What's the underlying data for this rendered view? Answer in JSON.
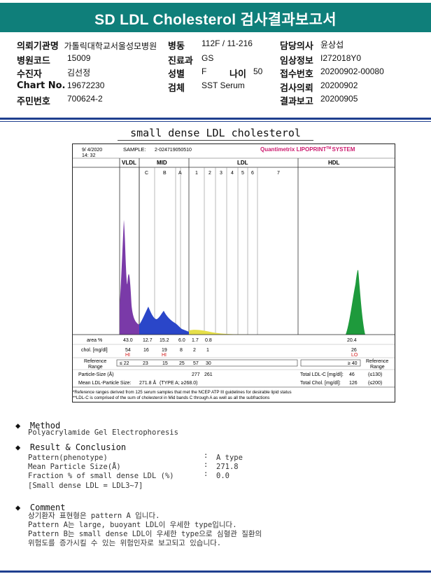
{
  "header": {
    "title": "SD LDL Cholesterol 검사결과보고서"
  },
  "info": {
    "col1": [
      {
        "label": "의뢰기관명",
        "value": "가톨릭대학교서울성모병원"
      },
      {
        "label": "병원코드",
        "value": "15009"
      },
      {
        "label": "수진자",
        "value": "김선정"
      },
      {
        "label": "Chart No.",
        "value": "19672230"
      },
      {
        "label": "주민번호",
        "value": "700624-2"
      }
    ],
    "col2": [
      {
        "label": "병동",
        "value": "112F / 11-216"
      },
      {
        "label": "진료과",
        "value": "GS"
      },
      {
        "label": "성별",
        "value": "F",
        "label2": "나이",
        "value2": "50"
      },
      {
        "label": "검체",
        "value": "SST Serum"
      }
    ],
    "col3": [
      {
        "label": "담당의사",
        "value": "윤상섭"
      },
      {
        "label": "임상정보",
        "value": "I272018Y0"
      },
      {
        "label": "접수번호",
        "value": "20200902-00080"
      },
      {
        "label": "검사의뢰",
        "value": "20200902"
      },
      {
        "label": "결과보고",
        "value": "20200905"
      }
    ]
  },
  "report_title": "small dense LDL cholesterol",
  "figure": {
    "date": "9/ 4/2020",
    "time": "14: 32",
    "sample_label": "SAMPLE:",
    "sample_id": "2-024719050510",
    "brand": "Quantimetrix LIPOPRINT",
    "brand_tm": "TM",
    "brand_suffix": "SYSTEM",
    "bands": {
      "vldl": "VLDL",
      "mid": "MID",
      "ldl": "LDL",
      "hdl": "HDL"
    },
    "sub_bands": [
      "C",
      "B",
      "A",
      "1",
      "2",
      "3",
      "4",
      "5",
      "6",
      "7"
    ],
    "rows": {
      "area_label": "area %",
      "area": [
        "43.0",
        "12.7",
        "15.2",
        "6.0",
        "1.7",
        "0.8"
      ],
      "area_hdl": "20.4",
      "chol_label": "chol. [mg/dl]",
      "chol": [
        "54",
        "16",
        "19",
        "8",
        "2",
        "1"
      ],
      "chol_hdl": "26",
      "flag_hi": "HI",
      "flag_hi2": "HI",
      "flag_lo": "LO",
      "ref_label1": "Reference",
      "ref_label2": "Range",
      "ref": [
        "≤ 22",
        "23",
        "15",
        "25",
        "57",
        "30"
      ],
      "ref_hdl": "≥ 40",
      "particle_label": "Particle-Size (Å)",
      "particle": [
        "277",
        "261"
      ],
      "mean_label": "Mean LDL-Particle Size:",
      "mean_value": "271.8 Å",
      "mean_type": "(TYPE A; ≥268.0)",
      "total_ldl_label": "Total LDL-C [mg/dl]:",
      "total_ldl": "46",
      "total_ldl_ref": "(≤130)",
      "total_chol_label": "Total Chol. [mg/dl]:",
      "total_chol": "126",
      "total_chol_ref": "(≤200)",
      "ref_right1": "Reference",
      "ref_right2": "Range"
    },
    "footnote1": "*Reference ranges derived from 125 serum samples that met the NCEP ATP III guidelines for desirable lipid status",
    "footnote2": "**LDL-C is comprised of the sum of cholesterol in Mid bands C through A as well as all the subfractions",
    "colors": {
      "vldl": "#7a3aa8",
      "mid": "#2a46c9",
      "ldl": "#e6e04a",
      "hdl": "#1e9a3c",
      "brand": "#cc1a6e",
      "flag": "#d21818"
    }
  },
  "method": {
    "heading": "Method",
    "text": "Polyacrylamide Gel Electrophoresis"
  },
  "result": {
    "heading": "Result & Conclusion",
    "items": [
      {
        "label": "Pattern(phenotype)",
        "value": "A type"
      },
      {
        "label": "Mean Particle Size(Å)",
        "value": "271.8"
      },
      {
        "label": "Fraction % of small dense LDL (%)",
        "value": "0.0"
      }
    ],
    "note": "[Small dense LDL = LDL3~7]",
    "colon": ":"
  },
  "comment": {
    "heading": "Comment",
    "lines": [
      "상기환자 표현형은 pattern A 입니다.",
      "Pattern A는 large, buoyant LDL이 우세한 type입니다.",
      "Pattern B는 small dense LDL이 우세한 type으로 심혈관 질환의",
      "위험도를 증가시킬 수 있는 위험인자로 보고되고 있습니다."
    ]
  },
  "bullet": "◆"
}
